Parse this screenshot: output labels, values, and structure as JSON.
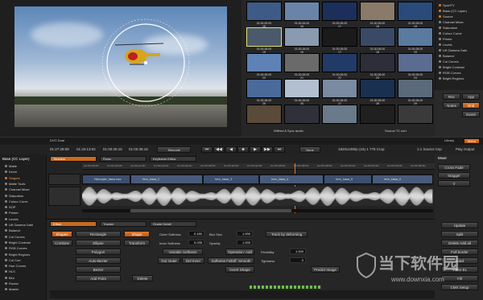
{
  "viewer": {
    "bottom_label": "DVO Dual"
  },
  "gallery": {
    "thumbs": [
      {
        "tc": "01:00:00:00",
        "num": "15",
        "color": "#3e5a86"
      },
      {
        "tc": "01:00:26:00",
        "num": "16",
        "color": "#6a84a8"
      },
      {
        "tc": "01:00:26:00",
        "num": "17",
        "color": "#1c2f5a"
      },
      {
        "tc": "01:00:26:00",
        "num": "18",
        "color": "#8a7a6a"
      },
      {
        "tc": "01:00:26:00",
        "num": "19",
        "color": "#2a4a7a"
      },
      {
        "tc": "01:00:26:00",
        "num": "15",
        "color": "#4a5a6a"
      },
      {
        "tc": "01:00:26:00",
        "num": "16",
        "color": "#8a9ab0"
      },
      {
        "tc": "01:00:26:00",
        "num": "17",
        "color": "#1a1a1a"
      },
      {
        "tc": "01:00:26:00",
        "num": "18",
        "color": "#3a4a66"
      },
      {
        "tc": "01:00:26:00",
        "num": "19",
        "color": "#5a7aa0"
      },
      {
        "tc": "01:00:26:00",
        "num": "20",
        "color": "#5e82b6"
      },
      {
        "tc": "01:00:26:00",
        "num": "21",
        "color": "#6a6a6a"
      },
      {
        "tc": "01:00:26:00",
        "num": "22",
        "color": "#223a66"
      },
      {
        "tc": "01:00:26:00",
        "num": "23",
        "color": "#2e2e3a"
      },
      {
        "tc": "01:00:26:00",
        "num": "24",
        "color": "#5c6c90"
      },
      {
        "tc": "01:00:26:00",
        "num": "25",
        "color": "#4a6a9a"
      },
      {
        "tc": "01:00:26:00",
        "num": "26",
        "color": "#b2bfd0"
      },
      {
        "tc": "01:00:26:00",
        "num": "27",
        "color": "#7a8aa0"
      },
      {
        "tc": "01:00:26:00",
        "num": "28",
        "color": "#1a3050"
      },
      {
        "tc": "01:00:26:00",
        "num": "29",
        "color": "#5a6a7a"
      },
      {
        "tc": "",
        "num": "",
        "color": "#5a4a3a"
      },
      {
        "tc": "",
        "num": "",
        "color": "#30303a"
      },
      {
        "tc": "",
        "num": "",
        "color": "#6a7a8a"
      },
      {
        "tc": "",
        "num": "",
        "color": "#202020"
      },
      {
        "tc": "",
        "num": "",
        "color": "#3a3a3a"
      }
    ],
    "status_left": "Wilfred A Sync audio",
    "status_mid": "Source TC sort"
  },
  "right_tree": {
    "items": [
      "SportTV",
      "Base (CC Layer)",
      "Source",
      "Channel Mixer",
      "Saturation",
      "Colour Curve",
      "Printer",
      "Levels",
      "Lift Gamma Gain",
      "Balance",
      "Col Curves",
      "Bright Contrast",
      "RGB Curves",
      "Bright Regions"
    ]
  },
  "right_buttons": {
    "row1": [
      "Rec",
      "App"
    ],
    "row2": [
      "Notes",
      "Grid"
    ],
    "row3": [
      "Event"
    ]
  },
  "timecode_bar": {
    "tc1": "01:27:29:08",
    "tc2": "01:34:13:02",
    "tc3": "01:00:25:16",
    "tc4": "01:00:36:18",
    "mode": "Telecode",
    "none_btn": "None",
    "format": "1920x1080p (16) 1 778 Crop",
    "source_clip": "1:1 Source Clip",
    "play_output": "Play Output",
    "library": "Library",
    "menu": "Menu"
  },
  "left_tree": {
    "header": "Base (CC Layer)",
    "items": [
      "Matte",
      "Kevin",
      "Shapes",
      "Matte Tools",
      "Channel Mixer",
      "Saturation",
      "Colour Curve",
      "SOP",
      "Printer",
      "Levels",
      "Lift Gamma Gain",
      "Balance",
      "Col Curves",
      "Bright Contrast",
      "RGB Curves",
      "Bright Regions",
      "Col Corr",
      "Hue Curves",
      "HLS",
      "Blur",
      "Router",
      "Master"
    ]
  },
  "timeline": {
    "tabs": [
      "Timeline",
      "Rows",
      "Keyframe Editor"
    ],
    "rulers": [
      "01:00:18:00",
      "01:00:20:00",
      "01:00:22:00",
      "01:00:24:00",
      "01:00:26:00",
      "01:00:28:00",
      "01:00:30:00",
      "01:00:32:00",
      "01:00:34:00",
      "01:00:36:00",
      "01:00:38:00",
      "01:00:40:00",
      "01:00:42:00",
      "01:00:44:00",
      "01:00:46:00"
    ],
    "clips": [
      "Helicopter_kawa.mov",
      "hero_kawa_2",
      "hero_kawa_3",
      "hero_kawa_4",
      "hero_kawa_5",
      "hero_kawa_6"
    ],
    "mixer_header": "Mixer",
    "mixer_items": [
      "Cross Fade",
      "Stagger",
      "V"
    ]
  },
  "effect_panel": {
    "tabs": [
      "Effect",
      "Tracker",
      "Grade Detail"
    ],
    "col1": [
      "Shapes",
      "Combine"
    ],
    "col2": [
      "Rectangle",
      "Ellipse",
      "Polygon",
      "Auto-Bezier",
      "Bezier",
      "Add Point"
    ],
    "col3": [
      "Shape",
      "Transform"
    ],
    "delete": "Delete",
    "softness": [
      {
        "label": "Outer Softness",
        "value": "0.160"
      },
      {
        "label": "Inner Softness",
        "value": "0.035"
      }
    ],
    "var_soft": "Variable Softness",
    "outer_inner": [
      "Out Outer",
      "Del Inner"
    ],
    "blur_size": {
      "label": "Blur Size",
      "value": "1.000"
    },
    "opacity": {
      "label": "Opacity",
      "value": "1.000"
    },
    "operation_add": "Operation: Add",
    "falloff": "Softness Falloff: Smooth",
    "invert": "Invert Shape",
    "track_btn": "Track by deforming",
    "flexibility": {
      "label": "Flexibility",
      "value": "1.000"
    },
    "tightness": {
      "label": "Tightness",
      "value": "0"
    },
    "predict": "Predict Image"
  },
  "right_side": {
    "items": [
      "Update",
      "Split",
      "Delete Add all",
      "Full border",
      "Load",
      "Video EL",
      "Fill",
      "CMX Setup"
    ]
  },
  "watermark": {
    "cn": "当下软件园",
    "url": "www.downxia.com"
  }
}
